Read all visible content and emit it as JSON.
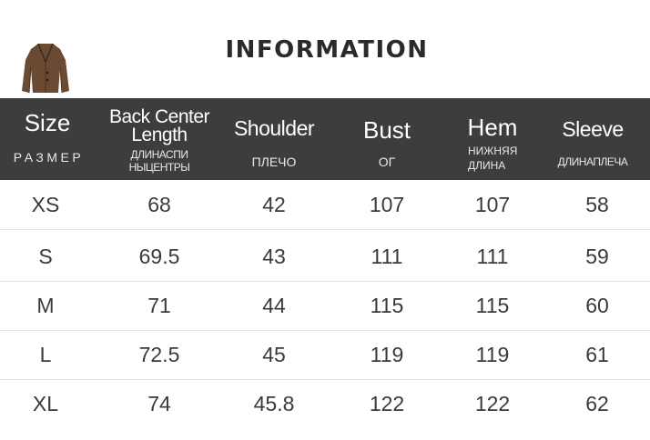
{
  "header": {
    "title": "INFORMATION",
    "image": "brown-blazer-thumbnail"
  },
  "columns": [
    {
      "en": "Size",
      "ru": "РАЗМЕР"
    },
    {
      "en_line1": "Back Center",
      "en_line2": "Length",
      "ru_line1": "ДЛИНАСПИ",
      "ru_line2": "НЫЦЕНТРЫ"
    },
    {
      "en": "Shoulder",
      "ru": "ПЛЕЧО"
    },
    {
      "en": "Bust",
      "ru": "ОГ"
    },
    {
      "en": "Hem",
      "ru_line1": "НИЖНЯЯ",
      "ru_line2": "ДЛИНА"
    },
    {
      "en": "Sleeve",
      "ru": "ДЛИНАПЛЕЧА"
    }
  ],
  "rows": [
    [
      "XS",
      "68",
      "42",
      "107",
      "107",
      "58"
    ],
    [
      "S",
      "69.5",
      "43",
      "111",
      "111",
      "59"
    ],
    [
      "M",
      "71",
      "44",
      "115",
      "115",
      "60"
    ],
    [
      "L",
      "72.5",
      "45",
      "119",
      "119",
      "61"
    ],
    [
      "XL",
      "74",
      "45.8",
      "122",
      "122",
      "62"
    ]
  ],
  "colors": {
    "header_bg": "#3d3d3d",
    "header_text": "#ffffff",
    "title_text": "#2a2a2a",
    "cell_text": "#3a3a3a",
    "row_divider": "#e3e3e3",
    "blazer": "#6b4a33"
  }
}
